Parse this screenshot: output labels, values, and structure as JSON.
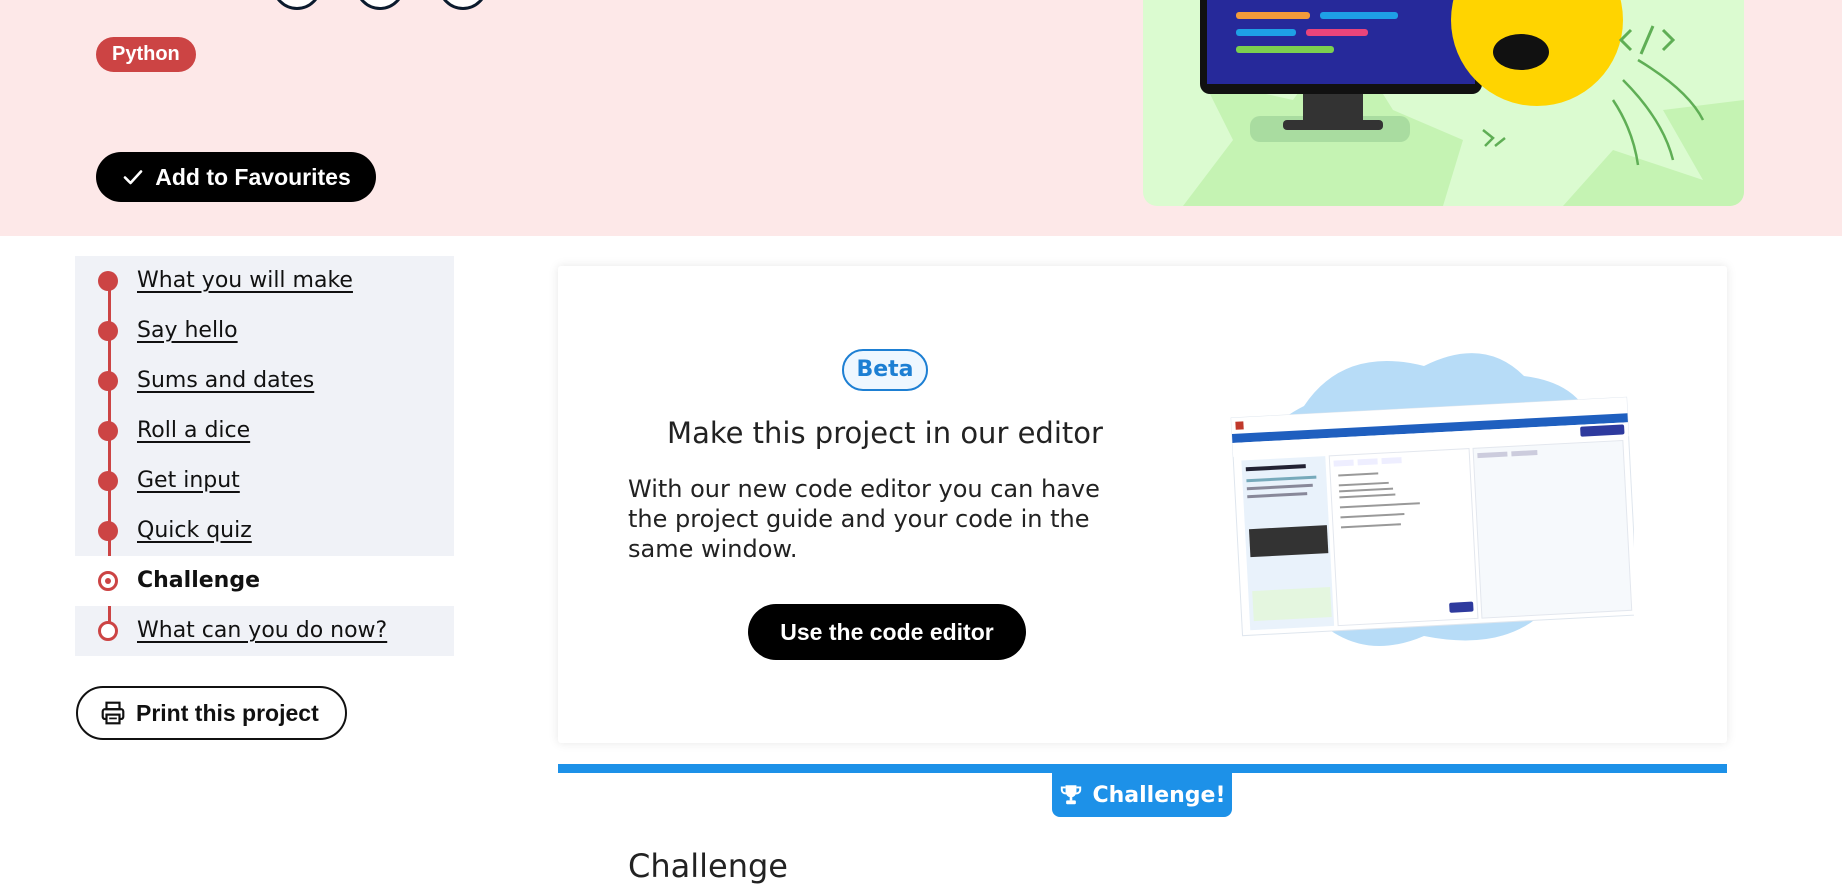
{
  "hero": {
    "tag": "Python",
    "favourite_label": "Add to Favourites"
  },
  "nav": {
    "items": [
      {
        "label": "What you will make",
        "state": "done"
      },
      {
        "label": "Say hello",
        "state": "done"
      },
      {
        "label": "Sums and dates",
        "state": "done"
      },
      {
        "label": "Roll a dice",
        "state": "done"
      },
      {
        "label": "Get input",
        "state": "done"
      },
      {
        "label": "Quick quiz",
        "state": "done"
      },
      {
        "label": "Challenge",
        "state": "current"
      },
      {
        "label": "What can you do now?",
        "state": "todo"
      }
    ],
    "print_label": "Print this project"
  },
  "editor_card": {
    "badge": "Beta",
    "title": "Make this project in our editor",
    "description": "With our new code editor you can have the project guide and your code in the same window.",
    "button_label": "Use the code editor"
  },
  "challenge": {
    "badge": "Challenge!",
    "heading": "Challenge"
  },
  "colors": {
    "hero_bg": "#fde8e8",
    "accent_red": "#cc4444",
    "challenge_blue": "#1d91e8",
    "beta_blue": "#1d7fd3"
  }
}
